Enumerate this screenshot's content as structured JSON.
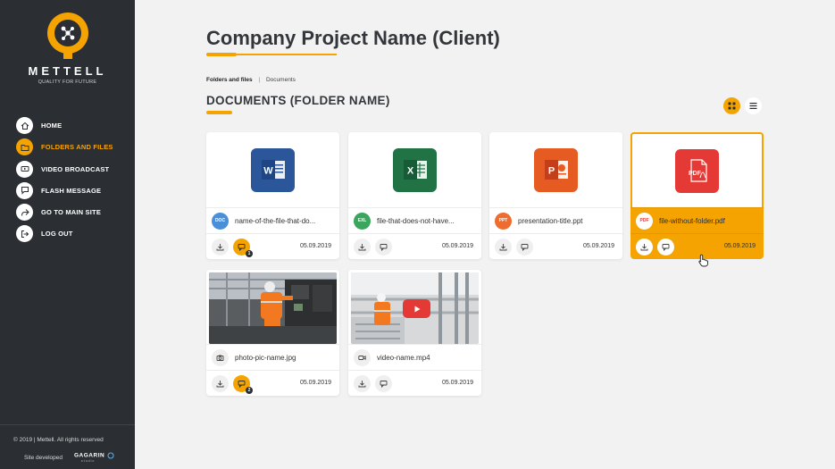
{
  "brand": {
    "name": "METTELL",
    "tagline": "QUALITY FOR FUTURE",
    "accent": "#f5a300",
    "sidebar_bg": "#2b2f33"
  },
  "nav": {
    "items": [
      {
        "label": "HOME",
        "icon": "home-icon"
      },
      {
        "label": "FOLDERS AND FILES",
        "icon": "folder-icon",
        "active": true
      },
      {
        "label": "VIDEO BROADCAST",
        "icon": "video-icon"
      },
      {
        "label": "FLASH MESSAGE",
        "icon": "message-icon"
      },
      {
        "label": "GO TO MAIN SITE",
        "icon": "share-arrow-icon"
      },
      {
        "label": "LOG OUT",
        "icon": "logout-icon"
      }
    ]
  },
  "footer": {
    "copyright": "© 2019   |   Mettell. All rights reserved",
    "developed_label": "Site developed",
    "developer": "GAGARIN",
    "developer_sub": "studio"
  },
  "header": {
    "title": "Company Project Name (Client)"
  },
  "breadcrumb": {
    "root": "Folders and files",
    "separator": "|",
    "current": "Documents"
  },
  "section": {
    "title": "DOCUMENTS (FOLDER NAME)"
  },
  "view_modes": {
    "grid": "grid-view-icon",
    "list": "list-view-icon",
    "active": "grid"
  },
  "files": [
    {
      "type": "doc",
      "badge": "DOC",
      "badge_color": "#4a90d9",
      "icon_color": "#2b579a",
      "name": "name-of-the-file-that-do...",
      "date": "05.09.2019",
      "message_count": "1",
      "has_messages": true
    },
    {
      "type": "xls",
      "badge": "EXL",
      "badge_color": "#3aa55d",
      "icon_color": "#217346",
      "name": "file-that-does-not-have...",
      "date": "05.09.2019",
      "has_messages": false
    },
    {
      "type": "ppt",
      "badge": "PPT",
      "badge_color": "#ee6c2e",
      "icon_color": "#e65b22",
      "name": "presentation-title.ppt",
      "date": "05.09.2019",
      "has_messages": false
    },
    {
      "type": "pdf",
      "badge": "PDF",
      "badge_color": "#e53935",
      "icon_color": "#e53935",
      "name": "file-without-folder.pdf",
      "date": "05.09.2019",
      "has_messages": false,
      "selected": true
    },
    {
      "type": "photo",
      "badge": "camera-icon",
      "name": "photo-pic-name.jpg",
      "date": "05.09.2019",
      "message_count": "2",
      "has_messages": true
    },
    {
      "type": "video",
      "badge": "video-camera-icon",
      "name": "video-name.mp4",
      "date": "05.09.2019",
      "has_messages": false
    }
  ]
}
